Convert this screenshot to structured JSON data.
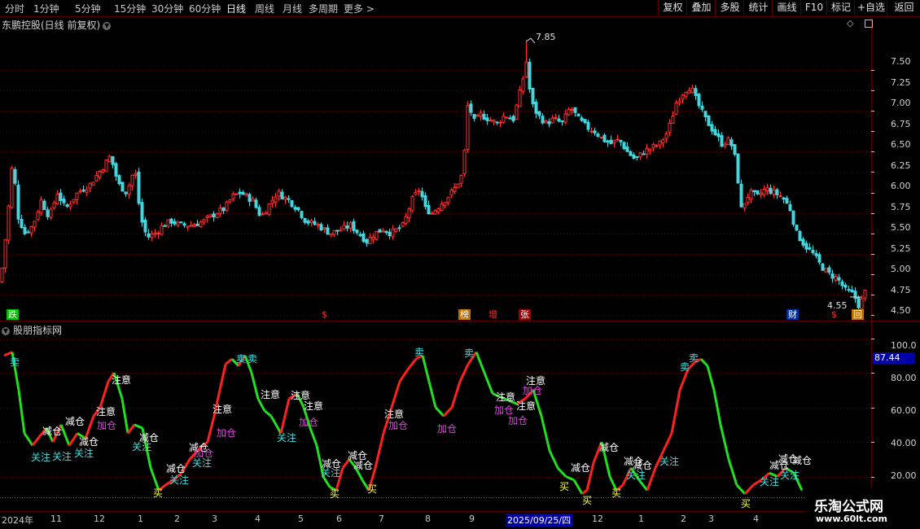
{
  "toolbar": {
    "periods": [
      "分时",
      "1分钟",
      "5分钟",
      "15分钟",
      "30分钟",
      "60分钟",
      "日线",
      "周线",
      "月线",
      "多周期",
      "更多"
    ],
    "buttons": [
      "复权",
      "叠加",
      "多股",
      "统计",
      "画线",
      "F10",
      "标记",
      "+自选",
      "返回"
    ]
  },
  "main": {
    "title": "东鹏控股(日线 前复权)",
    "high_label": "7.85",
    "low_label": "4.55",
    "y_ticks": [
      "7.50",
      "7.25",
      "7.00",
      "6.75",
      "6.50",
      "6.25",
      "6.00",
      "5.75",
      "5.50",
      "5.25",
      "5.00",
      "4.75",
      "4.50"
    ],
    "events": [
      {
        "text": "跌",
        "color": "#00c000",
        "fg": "#ffffff"
      },
      {
        "text": "$",
        "color": "#000000",
        "fg": "#ff3030"
      },
      {
        "text": "榜",
        "color": "#c07000",
        "fg": "#ffffff"
      },
      {
        "text": "增",
        "color": "#000000",
        "fg": "#ff3030"
      },
      {
        "text": "张",
        "color": "#a00000",
        "fg": "#ffffff"
      },
      {
        "text": "财",
        "color": "#0030a0",
        "fg": "#ffffff"
      },
      {
        "text": "$",
        "color": "#000000",
        "fg": "#ff3030"
      },
      {
        "text": "回",
        "color": "#c07000",
        "fg": "#ffffff"
      }
    ]
  },
  "indicator": {
    "title": "股朋指标网",
    "current_value": "87.44",
    "y_ticks": [
      "100.0",
      "80.00",
      "60.00",
      "40.00",
      "20.00"
    ],
    "signals": [
      {
        "text": "卖",
        "c": "#40e0e0"
      },
      {
        "text": "关注",
        "c": "#40e0e0"
      },
      {
        "text": "关注",
        "c": "#40e0e0"
      },
      {
        "text": "减仓",
        "c": "#ffffff"
      },
      {
        "text": "减仓",
        "c": "#ffffff"
      },
      {
        "text": "关注",
        "c": "#40e0e0"
      },
      {
        "text": "减仓",
        "c": "#ffffff"
      },
      {
        "text": "注意",
        "c": "#ffffff"
      },
      {
        "text": "注意",
        "c": "#ffffff"
      },
      {
        "text": "加仓",
        "c": "#e040e0"
      },
      {
        "text": "关注",
        "c": "#40e0e0"
      },
      {
        "text": "减仓",
        "c": "#ffffff"
      },
      {
        "text": "买",
        "c": "#ffff40"
      },
      {
        "text": "减仓",
        "c": "#ffffff"
      },
      {
        "text": "关注",
        "c": "#40e0e0"
      },
      {
        "text": "减仓",
        "c": "#ffffff"
      },
      {
        "text": "加仓",
        "c": "#e040e0"
      },
      {
        "text": "关注",
        "c": "#40e0e0"
      },
      {
        "text": "注意",
        "c": "#ffffff"
      },
      {
        "text": "加仓",
        "c": "#e040e0"
      },
      {
        "text": "卖",
        "c": "#40e0e0"
      },
      {
        "text": "卖",
        "c": "#40e0e0"
      },
      {
        "text": "注意",
        "c": "#ffffff"
      },
      {
        "text": "关注",
        "c": "#40e0e0"
      },
      {
        "text": "注意",
        "c": "#ffffff"
      },
      {
        "text": "加仓",
        "c": "#e040e0"
      },
      {
        "text": "注意",
        "c": "#ffffff"
      },
      {
        "text": "减仓",
        "c": "#ffffff"
      },
      {
        "text": "关注",
        "c": "#40e0e0"
      },
      {
        "text": "买",
        "c": "#ffff40"
      },
      {
        "text": "减仓",
        "c": "#ffffff"
      },
      {
        "text": "减仓",
        "c": "#ffffff"
      },
      {
        "text": "买",
        "c": "#ffff40"
      },
      {
        "text": "注意",
        "c": "#ffffff"
      },
      {
        "text": "加仓",
        "c": "#e040e0"
      },
      {
        "text": "卖",
        "c": "#40e0e0"
      },
      {
        "text": "加仓",
        "c": "#e040e0"
      },
      {
        "text": "卖",
        "c": "#40e0e0"
      },
      {
        "text": "注意",
        "c": "#ffffff"
      },
      {
        "text": "加仓",
        "c": "#e040e0"
      },
      {
        "text": "注意",
        "c": "#ffffff"
      },
      {
        "text": "加仓",
        "c": "#e040e0"
      },
      {
        "text": "注意",
        "c": "#ffffff"
      },
      {
        "text": "加仓",
        "c": "#e040e0"
      },
      {
        "text": "买",
        "c": "#ffff40"
      },
      {
        "text": "减仓",
        "c": "#ffffff"
      },
      {
        "text": "买",
        "c": "#ffff40"
      },
      {
        "text": "减仓",
        "c": "#ffffff"
      },
      {
        "text": "买",
        "c": "#ffff40"
      },
      {
        "text": "减仓",
        "c": "#ffffff"
      },
      {
        "text": "关注",
        "c": "#40e0e0"
      },
      {
        "text": "减仓",
        "c": "#ffffff"
      },
      {
        "text": "关注",
        "c": "#40e0e0"
      },
      {
        "text": "卖",
        "c": "#40e0e0"
      },
      {
        "text": "卖",
        "c": "#40e0e0"
      },
      {
        "text": "买",
        "c": "#ffff40"
      },
      {
        "text": "减仓",
        "c": "#ffffff"
      },
      {
        "text": "关注",
        "c": "#40e0e0"
      },
      {
        "text": "减仓",
        "c": "#ffffff"
      },
      {
        "text": "减仓",
        "c": "#ffffff"
      },
      {
        "text": "关注",
        "c": "#40e0e0"
      }
    ]
  },
  "xaxis": {
    "labels": [
      "2024年",
      "11",
      "12",
      "1",
      "2",
      "3",
      "4",
      "5",
      "6",
      "7",
      "8",
      "9",
      "2025/09/25/四",
      "12",
      "1",
      "2",
      "3",
      "4"
    ]
  },
  "watermark": {
    "title": "乐淘公式网",
    "url": "www.60lt.com"
  },
  "colors": {
    "up": "#ff3030",
    "down": "#40d8e0",
    "ind_up": "#ff2020",
    "ind_down": "#20e020",
    "grid": "#5a0000",
    "highlight": "#0000a0"
  },
  "chart_data": [
    {
      "type": "candlestick",
      "title": "东鹏控股(日线 前复权)",
      "y_ticks": [
        7.5,
        7.25,
        7.0,
        6.75,
        6.5,
        6.25,
        6.0,
        5.75,
        5.5,
        5.25,
        5.0,
        4.75,
        4.5
      ],
      "ylim": [
        4.45,
        8.0
      ],
      "annotations": [
        {
          "label": "7.85",
          "value": 7.85,
          "kind": "high"
        },
        {
          "label": "4.55",
          "value": 4.55,
          "kind": "low"
        }
      ],
      "close_path": [
        [
          0,
          4.9
        ],
        [
          8,
          5.6
        ],
        [
          15,
          6.4
        ],
        [
          22,
          5.7
        ],
        [
          30,
          5.5
        ],
        [
          40,
          5.6
        ],
        [
          50,
          5.9
        ],
        [
          60,
          5.7
        ],
        [
          70,
          6.0
        ],
        [
          80,
          5.8
        ],
        [
          95,
          6.0
        ],
        [
          110,
          6.1
        ],
        [
          125,
          6.3
        ],
        [
          135,
          6.45
        ],
        [
          145,
          6.1
        ],
        [
          155,
          6.0
        ],
        [
          165,
          6.3
        ],
        [
          172,
          5.7
        ],
        [
          180,
          5.45
        ],
        [
          190,
          5.5
        ],
        [
          200,
          5.6
        ],
        [
          210,
          5.65
        ],
        [
          220,
          5.6
        ],
        [
          235,
          5.6
        ],
        [
          250,
          5.65
        ],
        [
          265,
          5.75
        ],
        [
          275,
          5.8
        ],
        [
          285,
          5.95
        ],
        [
          295,
          6.0
        ],
        [
          310,
          5.9
        ],
        [
          320,
          5.7
        ],
        [
          330,
          5.85
        ],
        [
          340,
          6.0
        ],
        [
          355,
          5.9
        ],
        [
          365,
          5.8
        ],
        [
          375,
          5.65
        ],
        [
          390,
          5.6
        ],
        [
          405,
          5.5
        ],
        [
          420,
          5.55
        ],
        [
          430,
          5.6
        ],
        [
          440,
          5.5
        ],
        [
          450,
          5.4
        ],
        [
          460,
          5.5
        ],
        [
          470,
          5.55
        ],
        [
          480,
          5.5
        ],
        [
          495,
          5.6
        ],
        [
          505,
          5.9
        ],
        [
          515,
          6.05
        ],
        [
          522,
          5.8
        ],
        [
          530,
          5.75
        ],
        [
          545,
          5.9
        ],
        [
          558,
          6.05
        ],
        [
          566,
          6.2
        ],
        [
          570,
          6.5
        ],
        [
          575,
          7.2
        ],
        [
          580,
          6.85
        ],
        [
          590,
          6.95
        ],
        [
          600,
          6.9
        ],
        [
          610,
          6.85
        ],
        [
          620,
          6.95
        ],
        [
          630,
          6.9
        ],
        [
          640,
          7.3
        ],
        [
          646,
          7.6
        ],
        [
          652,
          7.1
        ],
        [
          660,
          6.95
        ],
        [
          670,
          6.85
        ],
        [
          680,
          6.9
        ],
        [
          690,
          6.85
        ],
        [
          700,
          7.05
        ],
        [
          710,
          6.9
        ],
        [
          720,
          6.8
        ],
        [
          730,
          6.75
        ],
        [
          740,
          6.65
        ],
        [
          750,
          6.6
        ],
        [
          760,
          6.65
        ],
        [
          770,
          6.5
        ],
        [
          780,
          6.4
        ],
        [
          790,
          6.5
        ],
        [
          800,
          6.55
        ],
        [
          810,
          6.6
        ],
        [
          820,
          6.75
        ],
        [
          830,
          7.1
        ],
        [
          840,
          7.25
        ],
        [
          848,
          7.3
        ],
        [
          856,
          7.1
        ],
        [
          866,
          6.9
        ],
        [
          876,
          6.75
        ],
        [
          886,
          6.6
        ],
        [
          896,
          6.65
        ],
        [
          903,
          6.4
        ],
        [
          910,
          5.8
        ],
        [
          920,
          6.0
        ],
        [
          930,
          5.95
        ],
        [
          940,
          6.05
        ],
        [
          950,
          6.0
        ],
        [
          960,
          5.95
        ],
        [
          970,
          5.8
        ],
        [
          978,
          5.5
        ],
        [
          988,
          5.35
        ],
        [
          998,
          5.25
        ],
        [
          1008,
          5.1
        ],
        [
          1018,
          5.0
        ],
        [
          1028,
          4.95
        ],
        [
          1038,
          4.8
        ],
        [
          1048,
          4.75
        ],
        [
          1055,
          4.6
        ],
        [
          1062,
          4.78
        ]
      ]
    },
    {
      "type": "line",
      "title": "股朋指标网",
      "y_ticks": [
        100,
        80,
        60,
        40,
        20
      ],
      "ylim": [
        0,
        105
      ],
      "current_value": 87.44,
      "series": [
        {
          "x": [
            0,
            10,
            18,
            25,
            35,
            45,
            52,
            60,
            70,
            80,
            90,
            100,
            110,
            118,
            128,
            135,
            145,
            152,
            160,
            170,
            180,
            190,
            198,
            208,
            218,
            228,
            240,
            250,
            258,
            265,
            272,
            280,
            288,
            296,
            304,
            312,
            320,
            328,
            340,
            350,
            360,
            368,
            376,
            384,
            392,
            400,
            408,
            416,
            424,
            432,
            440,
            448,
            456,
            466,
            476,
            486,
            496,
            506,
            514,
            522,
            530,
            540,
            550,
            560,
            570,
            580,
            590,
            600,
            610,
            620,
            630,
            640,
            650,
            660,
            670,
            680,
            690,
            700,
            710,
            716,
            724,
            734,
            744,
            752,
            760,
            770,
            780,
            790,
            800,
            810,
            820,
            830,
            840,
            848,
            856,
            864,
            872,
            880,
            890,
            900,
            910,
            920,
            930,
            940,
            950,
            960,
            970,
            980
          ],
          "y": [
            90,
            92,
            70,
            45,
            38,
            44,
            48,
            40,
            50,
            38,
            45,
            42,
            55,
            60,
            75,
            80,
            65,
            45,
            50,
            48,
            25,
            12,
            15,
            18,
            22,
            30,
            36,
            40,
            55,
            70,
            85,
            88,
            84,
            90,
            80,
            65,
            58,
            55,
            45,
            65,
            68,
            60,
            48,
            38,
            20,
            14,
            12,
            25,
            30,
            25,
            18,
            12,
            25,
            45,
            60,
            75,
            82,
            88,
            90,
            75,
            60,
            55,
            60,
            75,
            85,
            92,
            80,
            68,
            66,
            64,
            62,
            65,
            70,
            55,
            35,
            25,
            20,
            18,
            10,
            12,
            28,
            40,
            20,
            12,
            15,
            25,
            18,
            12,
            25,
            35,
            45,
            70,
            82,
            86,
            88,
            84,
            70,
            50,
            30,
            15,
            10,
            15,
            18,
            22,
            20,
            25,
            22,
            12
          ]
        }
      ]
    }
  ]
}
